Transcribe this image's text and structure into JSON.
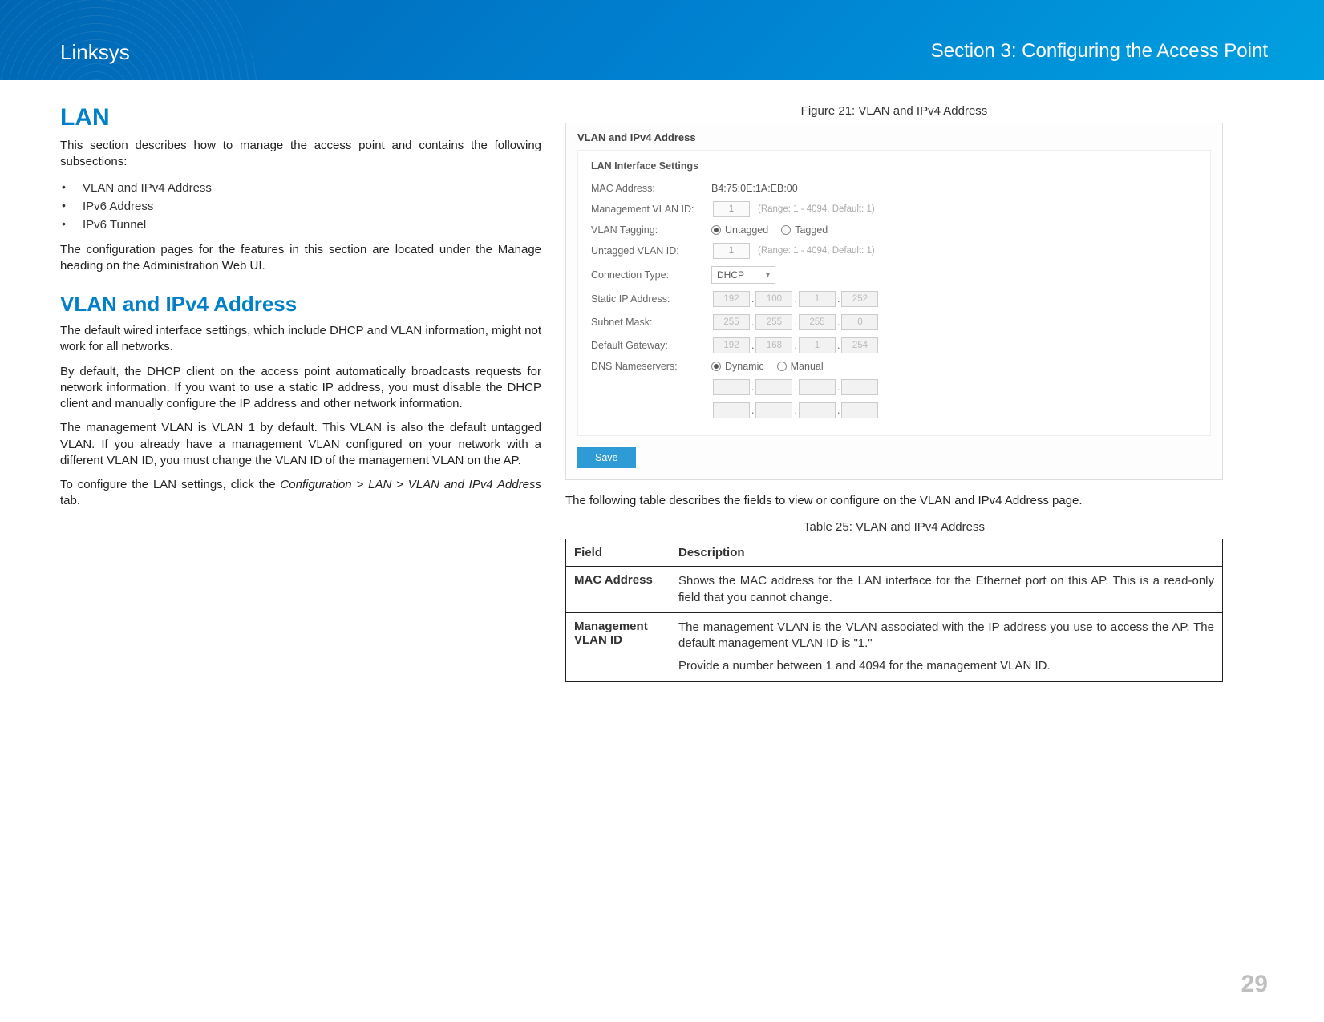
{
  "header": {
    "brand": "Linksys",
    "section": "Section 3:  Configuring the Access Point"
  },
  "left": {
    "h1": "LAN",
    "p1": "This section describes how to manage the access point and contains the following subsections:",
    "bullets": [
      "VLAN and IPv4 Address",
      "IPv6 Address",
      "IPv6 Tunnel"
    ],
    "p2": "The configuration pages for the features in this section are located under the Manage heading on the Administration Web UI.",
    "h2": "VLAN and IPv4 Address",
    "p3": "The default wired interface settings, which include DHCP and VLAN information, might not work for all networks.",
    "p4": "By default, the DHCP client on the access point automatically broadcasts requests for network information. If you want to use a static IP address, you must disable the DHCP client and manually configure the IP address and other network information.",
    "p5": "The management VLAN is VLAN 1 by default. This VLAN is also the default untagged VLAN. If you already have a management VLAN configured on your network with a different VLAN ID, you must change the VLAN ID of the management VLAN on the AP.",
    "p6a": "To configure the LAN settings, click the ",
    "p6b": "Configuration > LAN > VLAN and IPv4 Address",
    "p6c": " tab."
  },
  "right": {
    "figcap": "Figure 21: VLAN and IPv4 Address",
    "fig": {
      "title": "VLAN and IPv4 Address",
      "panel_title": "LAN Interface Settings",
      "mac_label": "MAC Address:",
      "mac_value": "B4:75:0E:1A:EB:00",
      "mvlan_label": "Management VLAN ID:",
      "mvlan_value": "1",
      "range_hint": "(Range: 1 - 4094, Default: 1)",
      "vtag_label": "VLAN Tagging:",
      "vtag_untagged": "Untagged",
      "vtag_tagged": "Tagged",
      "uvlan_label": "Untagged VLAN ID:",
      "uvlan_value": "1",
      "conn_label": "Connection Type:",
      "conn_value": "DHCP",
      "staticip_label": "Static IP Address:",
      "ip": [
        "192",
        "100",
        "1",
        "252"
      ],
      "mask_label": "Subnet Mask:",
      "mask": [
        "255",
        "255",
        "255",
        "0"
      ],
      "gw_label": "Default Gateway:",
      "gw": [
        "192",
        "168",
        "1",
        "254"
      ],
      "dns_label": "DNS Nameservers:",
      "dns_dynamic": "Dynamic",
      "dns_manual": "Manual",
      "save": "Save"
    },
    "p_after_fig": "The following table describes the fields to view or configure on the VLAN and IPv4 Address page.",
    "tablecap": "Table 25: VLAN and IPv4 Address",
    "table": {
      "h_field": "Field",
      "h_desc": "Description",
      "r1_field": "MAC Address",
      "r1_desc": "Shows the MAC address for the LAN interface for the Ethernet port on this AP. This is a read-only field that you cannot change.",
      "r2_field": "Management VLAN ID",
      "r2_desc1": "The management VLAN is the VLAN associated with the IP address you use to access the AP. The default management VLAN ID is \"1.\"",
      "r2_desc2": "Provide a number between 1 and 4094 for the management VLAN ID."
    }
  },
  "page_number": "29"
}
